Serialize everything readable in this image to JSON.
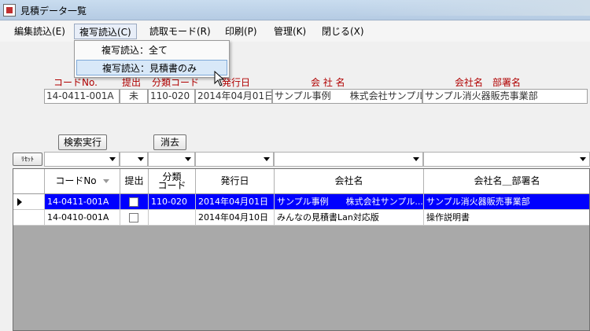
{
  "window": {
    "title": "見積データ一覧"
  },
  "menu": {
    "items": [
      {
        "label": "編集読込(E)"
      },
      {
        "label": "複写読込(C)"
      },
      {
        "label": "読取モード(R)"
      },
      {
        "label": "印刷(P)"
      },
      {
        "label": "管理(K)"
      },
      {
        "label": "閉じる(X)"
      }
    ],
    "dropdown": [
      {
        "label": "複写読込：全て"
      },
      {
        "label": "複写読込：見積書のみ"
      }
    ]
  },
  "info": {
    "headers": {
      "code": "コードNo.",
      "submit": "提出",
      "category": "分類コード",
      "issue_date": "発行日",
      "company": "会 社 名",
      "dept": "会社名　部署名"
    },
    "values": {
      "code": "14-0411-001A",
      "submit": "未",
      "category": "110-020",
      "issue_date": "2014年04月01日",
      "company": "サンプル事例　　株式会社サンプル",
      "dept": "サンプル消火器販売事業部"
    }
  },
  "buttons": {
    "search": "検索実行",
    "clear": "消去",
    "reset": "ﾘｾｯﾄ"
  },
  "grid": {
    "columns": {
      "code": "コードNo",
      "submit": "提出",
      "category": "分類\nコード",
      "issue_date": "発行日",
      "company": "会社名",
      "dept": "会社名＿部署名"
    },
    "rows": [
      {
        "code": "14-0411-001A",
        "category": "110-020",
        "issue_date": "2014年04月01日",
        "company": "サンプル事例　　株式会社サンプル...",
        "dept": "サンプル消火器販売事業部"
      },
      {
        "code": "14-0410-001A",
        "category": "",
        "issue_date": "2014年04月10日",
        "company": "みんなの見積書Lan対応版",
        "dept": "操作説明書"
      }
    ]
  },
  "colors": {
    "selection": "#0000ff",
    "header_text": "#b00000"
  }
}
